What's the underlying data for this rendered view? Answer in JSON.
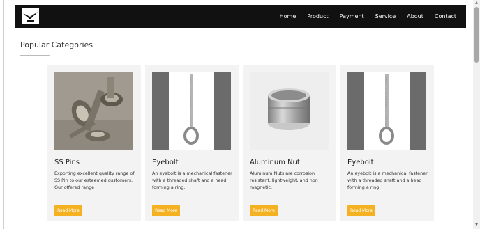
{
  "nav": {
    "items": [
      "Home",
      "Product",
      "Payment",
      "Service",
      "About",
      "Contact"
    ]
  },
  "section": {
    "title": "Popular Categories"
  },
  "cards": [
    {
      "title": "SS Pins",
      "description": "Exporting excellent quality range of SS Pin to our esteemed customers. Our offered range",
      "button": "Read More"
    },
    {
      "title": "Eyebolt",
      "description": "An eyebolt is a mechanical fastener with a threaded shaft and a head forming a ring.",
      "button": "Read More"
    },
    {
      "title": "Aluminum Nut",
      "description": "Aluminum Nuts are corrosion resistant, lightweight, and non magnetic.",
      "button": "Read More"
    },
    {
      "title": "Eyebolt",
      "description": "An eyebolt is a mechanical fastener with a threaded shaft and a head forming a ring",
      "button": "Read More"
    }
  ],
  "colors": {
    "navbar": "#111111",
    "accent": "#f4b223",
    "card_bg": "#f3f3f3"
  }
}
